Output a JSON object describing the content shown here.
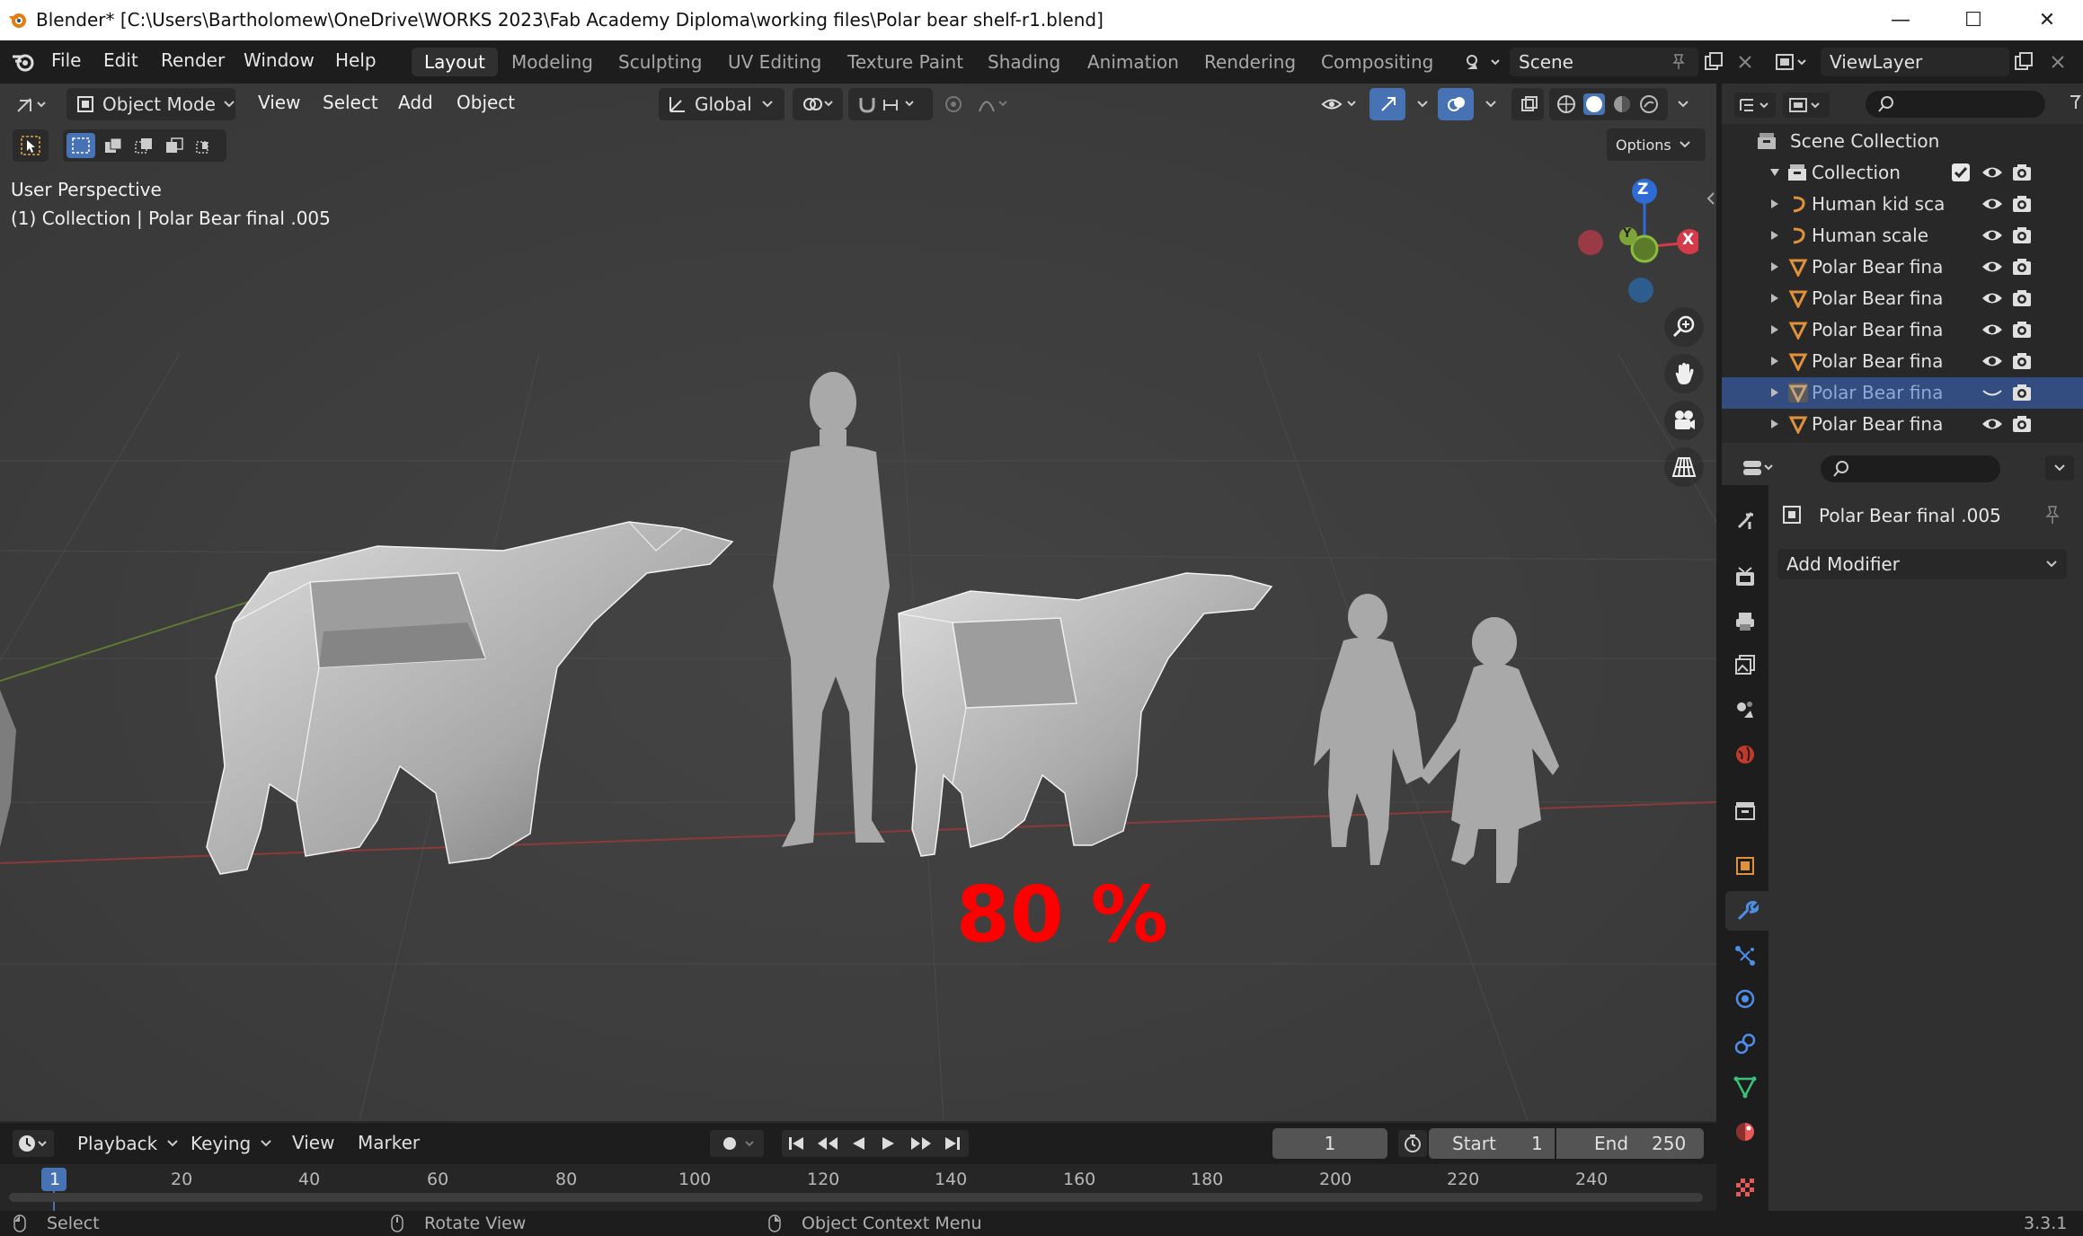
{
  "window": {
    "title": "Blender* [C:\\Users\\Bartholomew\\OneDrive\\WORKS 2023\\Fab Academy Diploma\\working files\\Polar bear shelf-r1.blend]",
    "minimize": "—",
    "maximize": "☐",
    "close": "✕"
  },
  "menu": {
    "items": [
      "File",
      "Edit",
      "Render",
      "Window",
      "Help"
    ]
  },
  "workspaces": {
    "tabs": [
      "Layout",
      "Modeling",
      "Sculpting",
      "UV Editing",
      "Texture Paint",
      "Shading",
      "Animation",
      "Rendering",
      "Compositing"
    ],
    "active": "Layout"
  },
  "scene": {
    "label": "Scene"
  },
  "viewlayer": {
    "label": "ViewLayer"
  },
  "viewport_header": {
    "mode": "Object Mode",
    "menus": [
      "View",
      "Select",
      "Add",
      "Object"
    ],
    "transform_orientation": "Global",
    "options": "Options"
  },
  "viewport": {
    "perspective_label": "User Perspective",
    "context_label": "(1) Collection | Polar Bear final .005",
    "overlay_text": "80 %",
    "overlay_color": "#ff0000",
    "gizmo": {
      "z": "Z",
      "y": "Y",
      "x": "X"
    }
  },
  "outliner": {
    "root": "Scene Collection",
    "collection": "Collection",
    "items": [
      {
        "label": "Human kid sca",
        "type": "armature",
        "selected": false
      },
      {
        "label": "Human scale",
        "type": "armature",
        "selected": false
      },
      {
        "label": "Polar Bear fina",
        "type": "mesh",
        "selected": false
      },
      {
        "label": "Polar Bear fina",
        "type": "mesh",
        "selected": false
      },
      {
        "label": "Polar Bear fina",
        "type": "mesh",
        "selected": false
      },
      {
        "label": "Polar Bear fina",
        "type": "mesh",
        "selected": false
      },
      {
        "label": "Polar Bear fina",
        "type": "mesh",
        "selected": true
      },
      {
        "label": "Polar Bear fina",
        "type": "mesh",
        "selected": false
      }
    ]
  },
  "properties": {
    "object_name": "Polar Bear final .005",
    "add_modifier": "Add Modifier"
  },
  "timeline": {
    "menus": [
      "Playback",
      "Keying",
      "View",
      "Marker"
    ],
    "current_frame": "1",
    "start_label": "Start",
    "start": "1",
    "end_label": "End",
    "end": "250",
    "ruler": [
      "1",
      "20",
      "40",
      "60",
      "80",
      "100",
      "120",
      "140",
      "160",
      "180",
      "200",
      "220",
      "240"
    ]
  },
  "statusbar": {
    "select": "Select",
    "rotate": "Rotate View",
    "context": "Object Context Menu",
    "version": "3.3.1"
  },
  "colors": {
    "accent": "#4772b3",
    "selection": "#334d80",
    "mesh_icon": "#e2913a",
    "background": "#303030"
  }
}
